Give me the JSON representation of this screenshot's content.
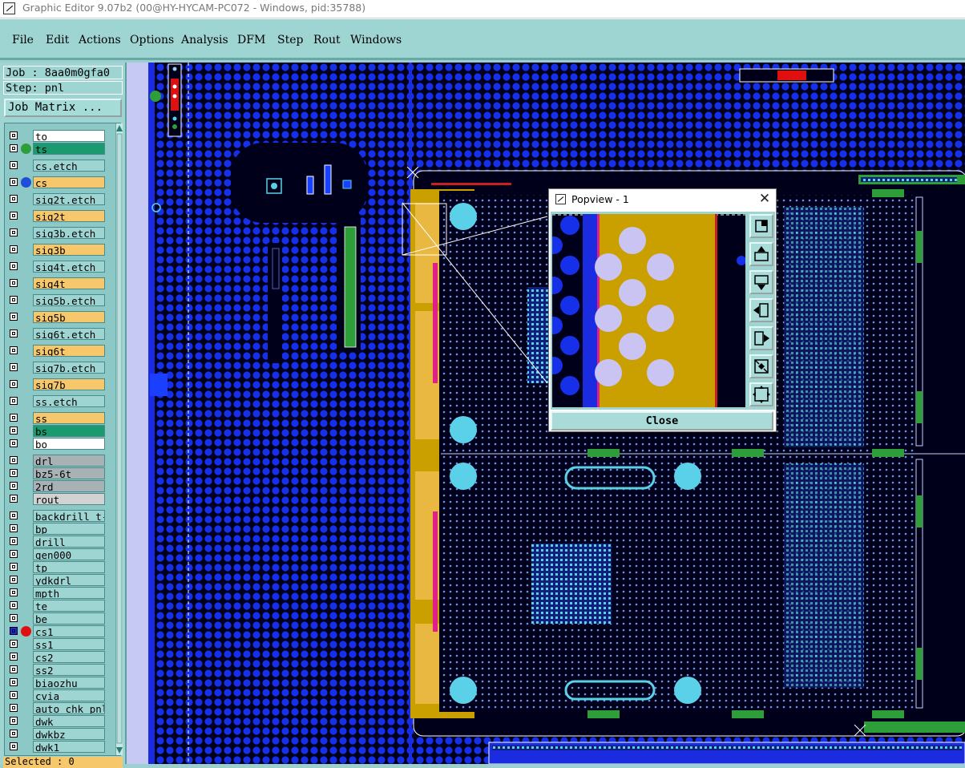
{
  "window": {
    "title": "Graphic Editor 9.07b2 (00@HY-HYCAM-PC072 - Windows, pid:35788)"
  },
  "menu": [
    "File",
    "Edit",
    "Actions",
    "Options",
    "Analysis",
    "DFM",
    "Step",
    "Rout",
    "Windows"
  ],
  "job": {
    "job_label": "Job : 8aa0m0gfa0",
    "step_label": "Step: pnl",
    "matrix_button": "Job Matrix ..."
  },
  "layers": [
    {
      "name": "to",
      "color": "white",
      "dot": ""
    },
    {
      "name": "ts",
      "color": "green",
      "dot": "#2e9e3a"
    },
    {
      "name": "cs.etch",
      "color": "teal",
      "dot": ""
    },
    {
      "name": "cs",
      "color": "orange",
      "dot": "#1f4fd8"
    },
    {
      "name": "sig2t.etch",
      "color": "teal",
      "dot": ""
    },
    {
      "name": "sig2t",
      "color": "orange",
      "dot": ""
    },
    {
      "name": "sig3b.etch",
      "color": "teal",
      "dot": ""
    },
    {
      "name": "sig3b",
      "color": "orange",
      "dot": ""
    },
    {
      "name": "sig4t.etch",
      "color": "teal",
      "dot": ""
    },
    {
      "name": "sig4t",
      "color": "orange",
      "dot": ""
    },
    {
      "name": "sig5b.etch",
      "color": "teal",
      "dot": ""
    },
    {
      "name": "sig5b",
      "color": "orange",
      "dot": ""
    },
    {
      "name": "sig6t.etch",
      "color": "teal",
      "dot": ""
    },
    {
      "name": "sig6t",
      "color": "orange",
      "dot": ""
    },
    {
      "name": "sig7b.etch",
      "color": "teal",
      "dot": ""
    },
    {
      "name": "sig7b",
      "color": "orange",
      "dot": ""
    },
    {
      "name": "ss.etch",
      "color": "teal",
      "dot": ""
    },
    {
      "name": "ss",
      "color": "orange",
      "dot": ""
    },
    {
      "name": "bs",
      "color": "green",
      "dot": ""
    },
    {
      "name": "bo",
      "color": "white",
      "dot": ""
    },
    {
      "name": "drl",
      "color": "gray",
      "dot": ""
    },
    {
      "name": "bz5-6t",
      "color": "gray",
      "dot": ""
    },
    {
      "name": "2rd",
      "color": "gray",
      "dot": ""
    },
    {
      "name": "rout",
      "color": "lightgray",
      "dot": ""
    },
    {
      "name": "backdrill_t-",
      "color": "teal",
      "dot": ""
    },
    {
      "name": "bp",
      "color": "teal",
      "dot": ""
    },
    {
      "name": "drill",
      "color": "teal",
      "dot": ""
    },
    {
      "name": "gen000",
      "color": "teal",
      "dot": ""
    },
    {
      "name": "tp",
      "color": "teal",
      "dot": ""
    },
    {
      "name": "ydkdrl",
      "color": "teal",
      "dot": ""
    },
    {
      "name": "mpth",
      "color": "teal",
      "dot": ""
    },
    {
      "name": "te",
      "color": "teal",
      "dot": ""
    },
    {
      "name": "be",
      "color": "teal",
      "dot": ""
    },
    {
      "name": "cs1",
      "color": "teal",
      "dot": "#e01010"
    },
    {
      "name": "ss1",
      "color": "teal",
      "dot": ""
    },
    {
      "name": "cs2",
      "color": "teal",
      "dot": ""
    },
    {
      "name": "ss2",
      "color": "teal",
      "dot": ""
    },
    {
      "name": "biaozhu",
      "color": "teal",
      "dot": ""
    },
    {
      "name": "cvia",
      "color": "teal",
      "dot": ""
    },
    {
      "name": "auto_chk_pnl",
      "color": "teal",
      "dot": ""
    },
    {
      "name": "dwk",
      "color": "teal",
      "dot": ""
    },
    {
      "name": "dwkbz",
      "color": "teal",
      "dot": ""
    },
    {
      "name": "dwk1",
      "color": "teal",
      "dot": ""
    }
  ],
  "selected_text": "Selected : 0",
  "popview": {
    "title": "Popview - 1",
    "close_label": "Close"
  },
  "colors": {
    "board_blue": "#1530e8",
    "gold": "#c9a000",
    "pad_cyan": "#5ad1e8",
    "copper_teal": "#7fd1e0"
  }
}
